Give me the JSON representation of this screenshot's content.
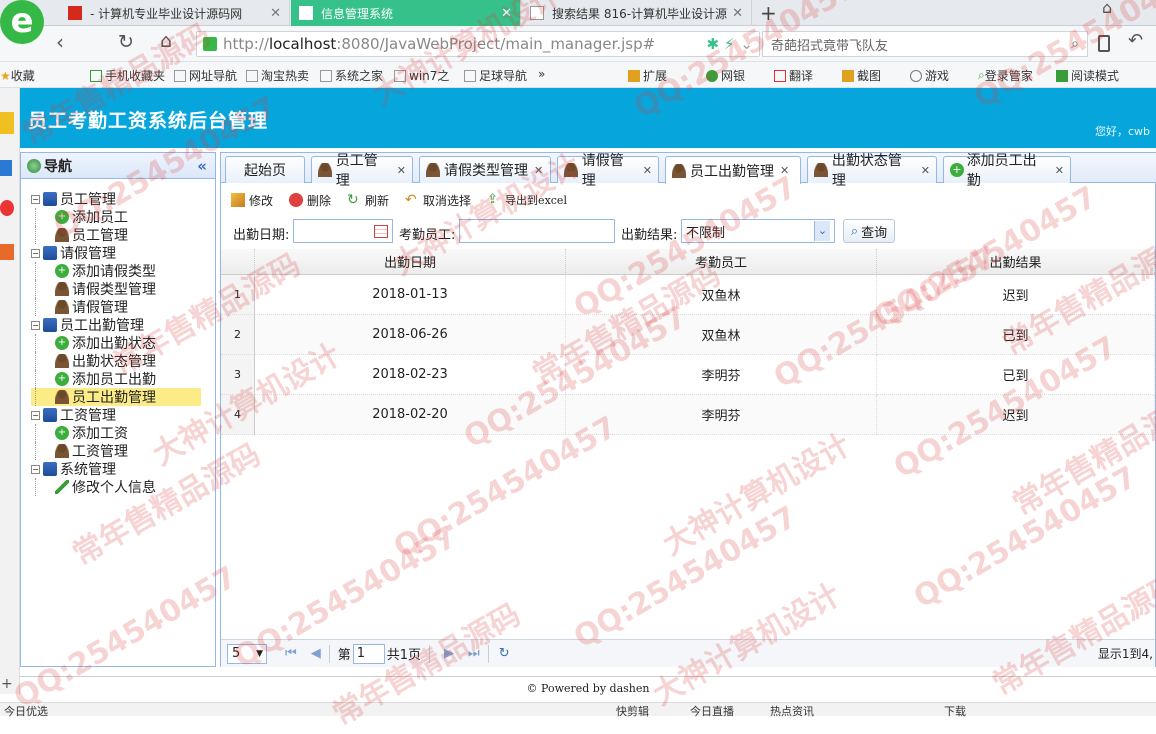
{
  "browser": {
    "tabs": [
      {
        "label": "- 计算机专业毕业设计源码网"
      },
      {
        "label": "信息管理系统"
      },
      {
        "label": "搜索结果 816-计算机毕业设计源"
      }
    ],
    "new_tab": "+",
    "url_scheme": "http://",
    "url_host": "localhost",
    "url_rest": ":8080/JavaWebProject/main_manager.jsp#",
    "search_text": "奇葩招式竟带飞队友",
    "bookmarks": [
      "收藏",
      "手机收藏夹",
      "网址导航",
      "淘宝热卖",
      "系统之家",
      "win7之",
      "足球导航",
      "»",
      "扩展",
      "网银",
      "翻译",
      "截图",
      "游戏",
      "登录管家",
      "阅读模式"
    ]
  },
  "app": {
    "title": "员工考勤工资系统后台管理",
    "greeting": "您好，cwb"
  },
  "nav": {
    "title": "导航",
    "collapse": "«",
    "items": [
      {
        "label": "员工管理",
        "level": 0
      },
      {
        "label": "添加员工",
        "level": 1,
        "icon": "add"
      },
      {
        "label": "员工管理",
        "level": 1,
        "icon": "user"
      },
      {
        "label": "请假管理",
        "level": 0
      },
      {
        "label": "添加请假类型",
        "level": 1,
        "icon": "add"
      },
      {
        "label": "请假类型管理",
        "level": 1,
        "icon": "user"
      },
      {
        "label": "请假管理",
        "level": 1,
        "icon": "user"
      },
      {
        "label": "员工出勤管理",
        "level": 0
      },
      {
        "label": "添加出勤状态",
        "level": 1,
        "icon": "add"
      },
      {
        "label": "出勤状态管理",
        "level": 1,
        "icon": "user"
      },
      {
        "label": "添加员工出勤",
        "level": 1,
        "icon": "add"
      },
      {
        "label": "员工出勤管理",
        "level": 1,
        "icon": "user",
        "selected": true
      },
      {
        "label": "工资管理",
        "level": 0
      },
      {
        "label": "添加工资",
        "level": 1,
        "icon": "add"
      },
      {
        "label": "工资管理",
        "level": 1,
        "icon": "user"
      },
      {
        "label": "系统管理",
        "level": 0
      },
      {
        "label": "修改个人信息",
        "level": 1,
        "icon": "pencil"
      }
    ]
  },
  "tabs": [
    {
      "label": "起始页"
    },
    {
      "label": "员工管理"
    },
    {
      "label": "请假类型管理"
    },
    {
      "label": "请假管理"
    },
    {
      "label": "员工出勤管理"
    },
    {
      "label": "出勤状态管理"
    },
    {
      "label": "添加员工出勤"
    }
  ],
  "toolbar": {
    "edit": "修改",
    "delete": "删除",
    "refresh": "刷新",
    "deselect": "取消选择",
    "export": "导出到excel"
  },
  "filters": {
    "date_label": "出勤日期:",
    "employee_label": "考勤员工:",
    "result_label": "出勤结果:",
    "result_value": "不限制",
    "query_button": "查询"
  },
  "grid": {
    "columns": [
      "出勤日期",
      "考勤员工",
      "出勤结果"
    ],
    "rows": [
      {
        "num": "1",
        "date": "2018-01-13",
        "employee": "双鱼林",
        "result": "迟到"
      },
      {
        "num": "2",
        "date": "2018-06-26",
        "employee": "双鱼林",
        "result": "已到"
      },
      {
        "num": "3",
        "date": "2018-02-23",
        "employee": "李明芬",
        "result": "已到"
      },
      {
        "num": "4",
        "date": "2018-02-20",
        "employee": "李明芬",
        "result": "迟到"
      }
    ]
  },
  "pager": {
    "page_size": "5",
    "page_prefix": "第",
    "page_value": "1",
    "page_total": "共1页",
    "display_info": "显示1到4,"
  },
  "footer": {
    "text": "© Powered by dashen"
  },
  "statusbar": {
    "left": "今日优选",
    "items": [
      "快剪辑",
      "今日直播",
      "热点资讯",
      "下载"
    ]
  },
  "watermarks": [
    "QQ:254540457",
    "大神计算机设计",
    "常年售精品源码"
  ],
  "colors": {
    "header": "#06a6dd",
    "active_tab": "#37c18a",
    "panel_border": "#95b8e7",
    "selected_node": "#fbec88"
  }
}
